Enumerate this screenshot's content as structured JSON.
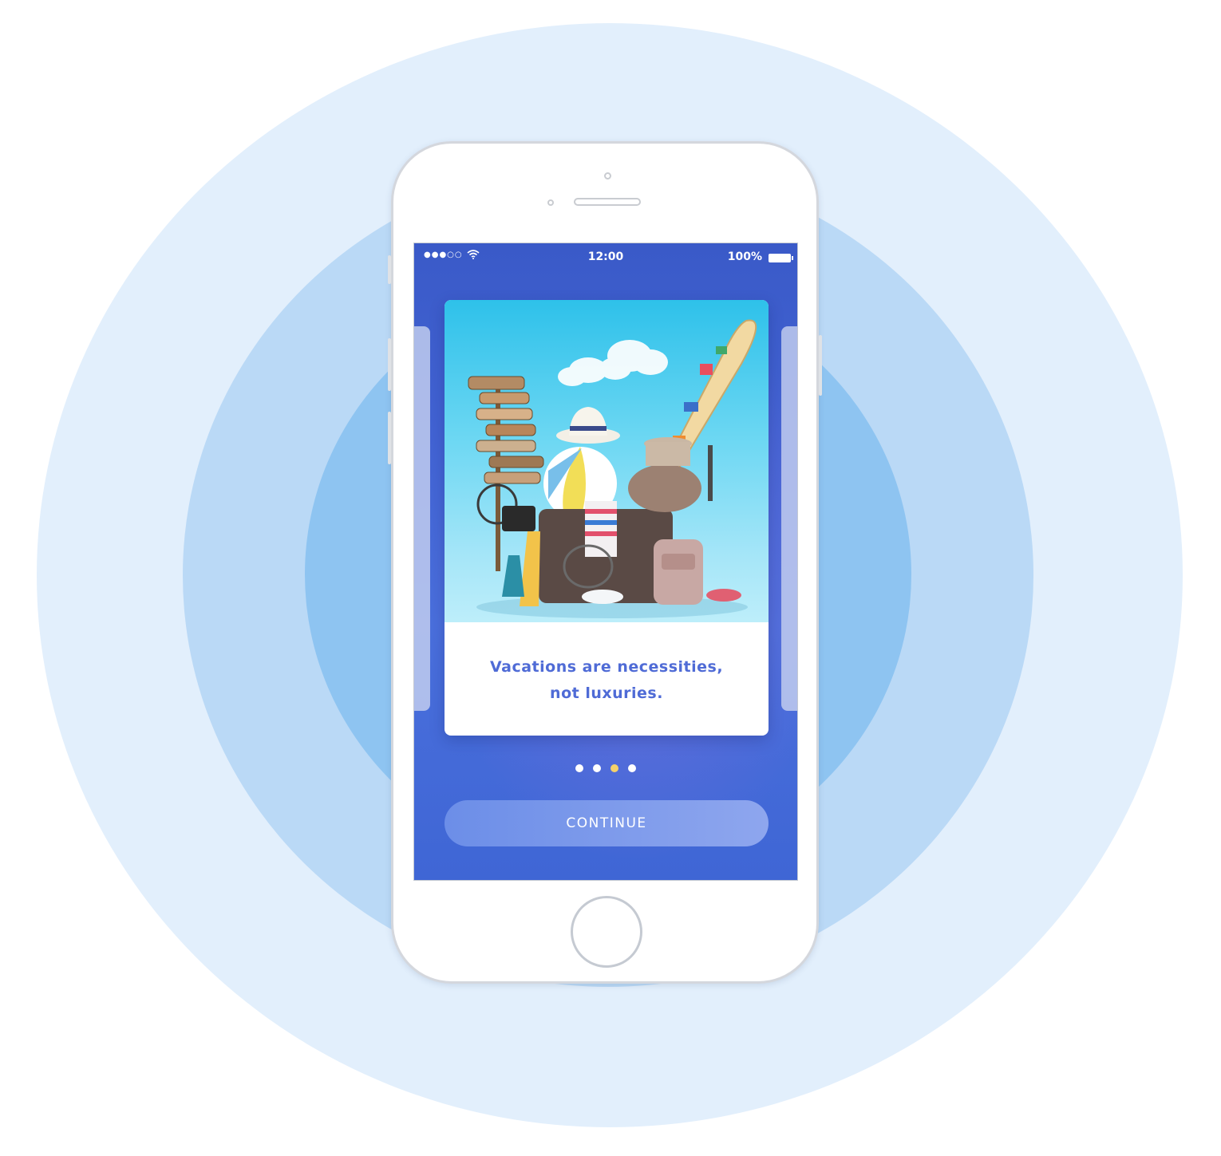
{
  "status_bar": {
    "signal": "●●●○○",
    "time": "12:00",
    "battery_text": "100%"
  },
  "onboarding": {
    "image_icon": "vacation-luggage-illustration",
    "caption_line1": "Vacations are necessities,",
    "caption_line2": "not luxuries.",
    "page_count": 4,
    "active_page": 3,
    "continue_label": "CONTINUE"
  },
  "colors": {
    "accent_text": "#4f6bd6",
    "active_dot": "#f5d26a",
    "background_rings": [
      "#e2effc",
      "#bad9f6",
      "#8ec4f1"
    ]
  }
}
